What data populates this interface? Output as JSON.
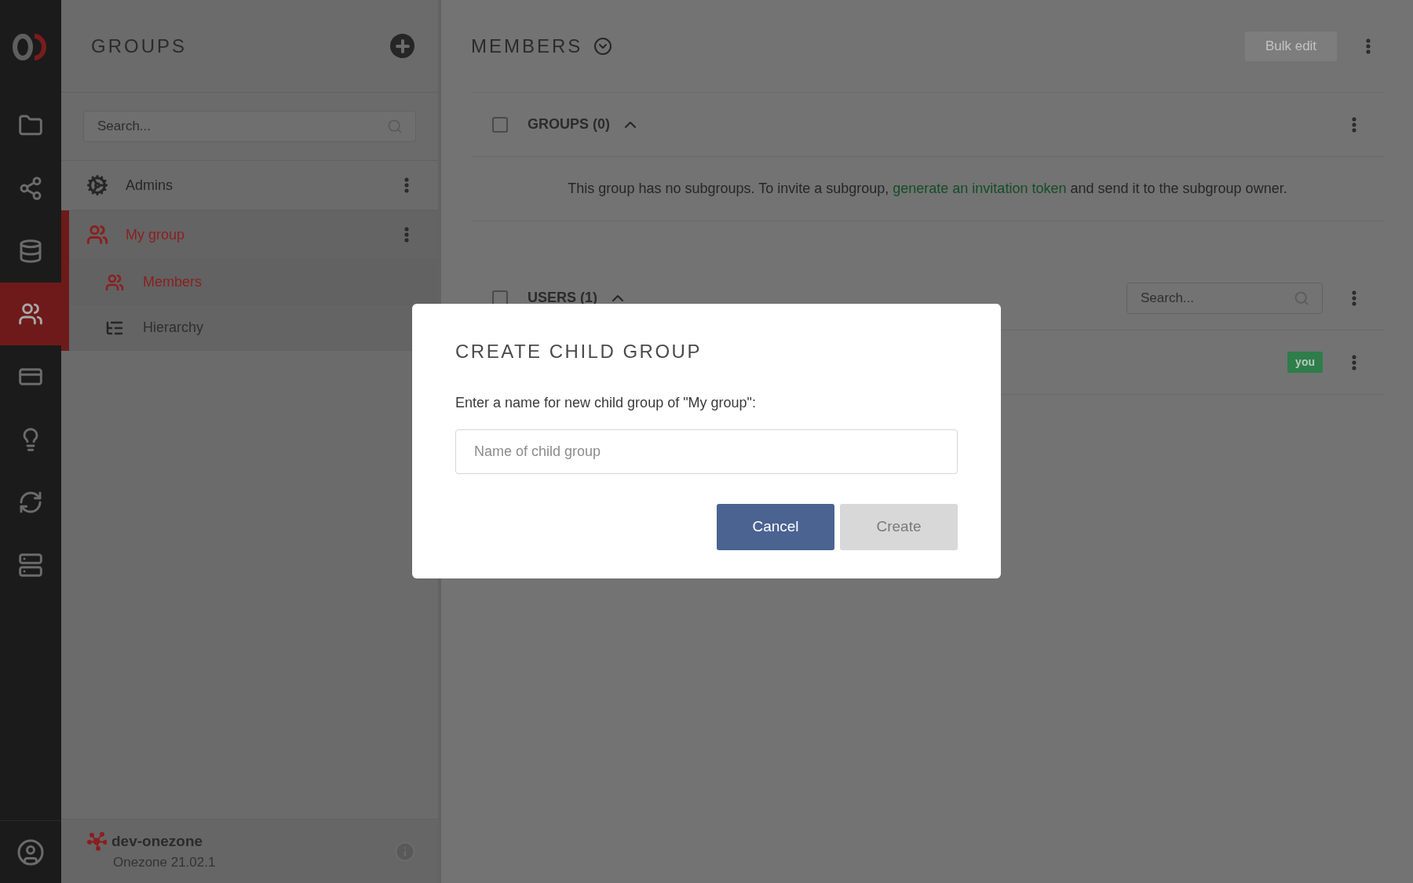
{
  "nav": {
    "items": [
      {
        "kind": "folder",
        "selected": false
      },
      {
        "kind": "share",
        "selected": false
      },
      {
        "kind": "database",
        "selected": false
      },
      {
        "kind": "groups",
        "selected": true
      },
      {
        "kind": "token",
        "selected": false
      },
      {
        "kind": "bulb",
        "selected": false
      },
      {
        "kind": "cluster",
        "selected": false
      },
      {
        "kind": "server",
        "selected": false
      }
    ]
  },
  "groups_panel": {
    "title": "GROUPS",
    "search": {
      "placeholder": "Search..."
    },
    "items": [
      {
        "name": "Admins",
        "kind": "admin",
        "selected": false
      },
      {
        "name": "My group",
        "kind": "group",
        "selected": true,
        "children": [
          {
            "name": "Members",
            "kind": "members",
            "selected": true
          },
          {
            "name": "Hierarchy",
            "kind": "hierarchy",
            "selected": false
          }
        ]
      }
    ],
    "footer": {
      "name": "dev-onezone",
      "version": "Onezone 21.02.1"
    }
  },
  "main": {
    "title": "MEMBERS",
    "bulk_edit": {
      "label": "Bulk edit",
      "disabled": true
    },
    "groups_section": {
      "title": "GROUPS (0)",
      "checked": false,
      "expanded": true,
      "message_before": "This group has no subgroups. To invite a subgroup, ",
      "link": "generate an invitation token",
      "message_after": " and send it to the subgroup owner."
    },
    "users_section": {
      "title": "USERS (1)",
      "checked": false,
      "expanded": true,
      "search": {
        "placeholder": "Search..."
      },
      "rows": [
        {
          "badge": "you"
        }
      ]
    }
  },
  "modal": {
    "title": "CREATE CHILD GROUP",
    "label": "Enter a name for new child group of \"My group\":",
    "input": {
      "placeholder": "Name of child group"
    },
    "buttons": [
      {
        "label": "Cancel",
        "disabled": false
      },
      {
        "label": "Create",
        "disabled": true
      }
    ]
  }
}
